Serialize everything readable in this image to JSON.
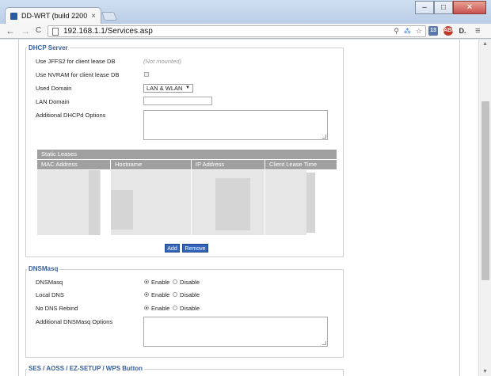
{
  "browser": {
    "tab_title": "DD-WRT (build 2200",
    "tab_close": "×",
    "url": "192.168.1.1/Services.asp",
    "back": "←",
    "forward": "→",
    "reload": "C",
    "menu": "≡",
    "window": {
      "minimize": "–",
      "maximize": "□",
      "close": "✕"
    },
    "extensions": [
      "13",
      "ABP",
      "D."
    ]
  },
  "dhcp": {
    "legend": "DHCP Server",
    "jffs2_label": "Use JFFS2 for client lease DB",
    "jffs2_value": "(Not mounted)",
    "nvram_label": "Use NVRAM for client lease DB",
    "used_domain_label": "Used Domain",
    "used_domain_value": "LAN & WLAN",
    "lan_domain_label": "LAN Domain",
    "dhcpd_options_label": "Additional DHCPd Options",
    "static_leases_title": "Static Leases",
    "columns": [
      "MAC Address",
      "Hostname",
      "IP Address",
      "Client Lease Time"
    ],
    "add_button": "Add",
    "remove_button": "Remove"
  },
  "dnsmasq": {
    "legend": "DNSMasq",
    "rows": [
      {
        "label": "DNSMasq",
        "enable": "Enable",
        "disable": "Disable",
        "selected": "enable"
      },
      {
        "label": "Local DNS",
        "enable": "Enable",
        "disable": "Disable",
        "selected": "enable"
      },
      {
        "label": "No DNS Rebind",
        "enable": "Enable",
        "disable": "Disable",
        "selected": "enable"
      }
    ],
    "options_label": "Additional DNSMasq Options"
  },
  "next_section": {
    "legend": "SES / AOSS / EZ-SETUP / WPS Button"
  }
}
